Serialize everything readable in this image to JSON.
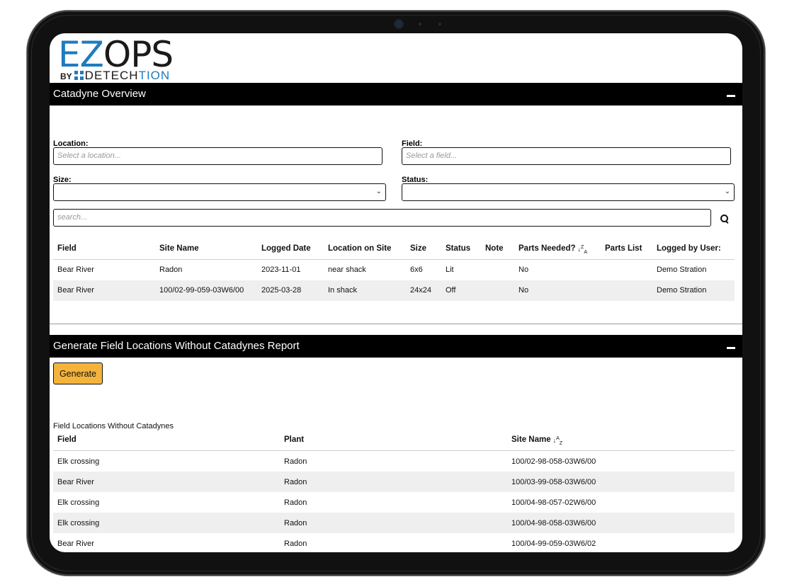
{
  "logo": {
    "ez": "EZ",
    "ops": "OPS",
    "by": "BY",
    "detech": "DETECH",
    "tion": "TION"
  },
  "overview": {
    "title": "Catadyne Overview",
    "filters": {
      "location_label": "Location:",
      "location_placeholder": "Select a location...",
      "field_label": "Field:",
      "field_placeholder": "Select a field...",
      "size_label": "Size:",
      "size_value": "",
      "status_label": "Status:",
      "status_value": "",
      "search_placeholder": "search..."
    },
    "columns": [
      "Field",
      "Site Name",
      "Logged Date",
      "Location on Site",
      "Size",
      "Status",
      "Note",
      "Parts Needed?",
      "Parts List",
      "Logged by User:"
    ],
    "sort_icon": "sort-descending-icon",
    "rows": [
      [
        "Bear River",
        "Radon",
        "2023-11-01",
        "near shack",
        "6x6",
        "Lit",
        "",
        "No",
        "",
        "Demo Stration"
      ],
      [
        "Bear River",
        "100/02-99-059-03W6/00",
        "2025-03-28",
        "In shack",
        "24x24",
        "Off",
        "",
        "No",
        "",
        "Demo Stration"
      ]
    ]
  },
  "report": {
    "title": "Generate Field Locations Without Catadynes Report",
    "generate_label": "Generate",
    "button_color": "#f4b43c",
    "caption": "Field Locations Without Catadynes",
    "columns": [
      "Field",
      "Plant",
      "Site Name"
    ],
    "sort_icon": "sort-ascending-icon",
    "rows": [
      [
        "Elk crossing",
        "Radon",
        "100/02-98-058-03W6/00"
      ],
      [
        "Bear River",
        "Radon",
        "100/03-99-058-03W6/00"
      ],
      [
        "Elk crossing",
        "Radon",
        "100/04-98-057-02W6/00"
      ],
      [
        "Elk crossing",
        "Radon",
        "100/04-98-058-03W6/00"
      ],
      [
        "Bear River",
        "Radon",
        "100/04-99-059-03W6/02"
      ]
    ]
  },
  "colors": {
    "brand_blue": "#1f7bbf",
    "header_bar": "#000000",
    "row_stripe": "#efefef"
  }
}
